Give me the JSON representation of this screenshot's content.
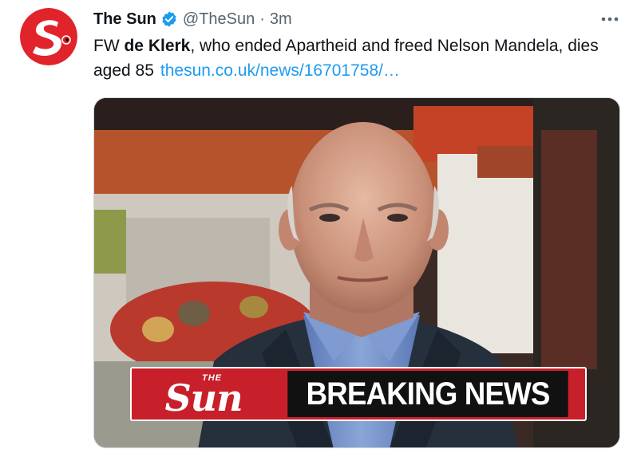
{
  "tweet": {
    "display_name": "The Sun",
    "handle": "@TheSun",
    "separator": "·",
    "time": "3m",
    "text_prefix": "FW ",
    "text_bold": "de Klerk",
    "text_suffix": ", who ended Apartheid and freed Nelson Mandela, dies aged 85",
    "link_text": "thesun.co.uk/news/16701758/…"
  },
  "media": {
    "logo_the": "THE",
    "logo_sun": "Sun",
    "banner_text": "BREAKING NEWS"
  },
  "icons": {
    "avatar": "the-sun-logo",
    "verified": "verified-badge-icon",
    "more": "more-icon"
  },
  "colors": {
    "brand_red": "#e1232b",
    "verified_blue": "#1d9bf0",
    "link_blue": "#1d9bf0",
    "secondary_text": "#536471",
    "banner_red": "#c8202a",
    "banner_black": "#111111"
  }
}
